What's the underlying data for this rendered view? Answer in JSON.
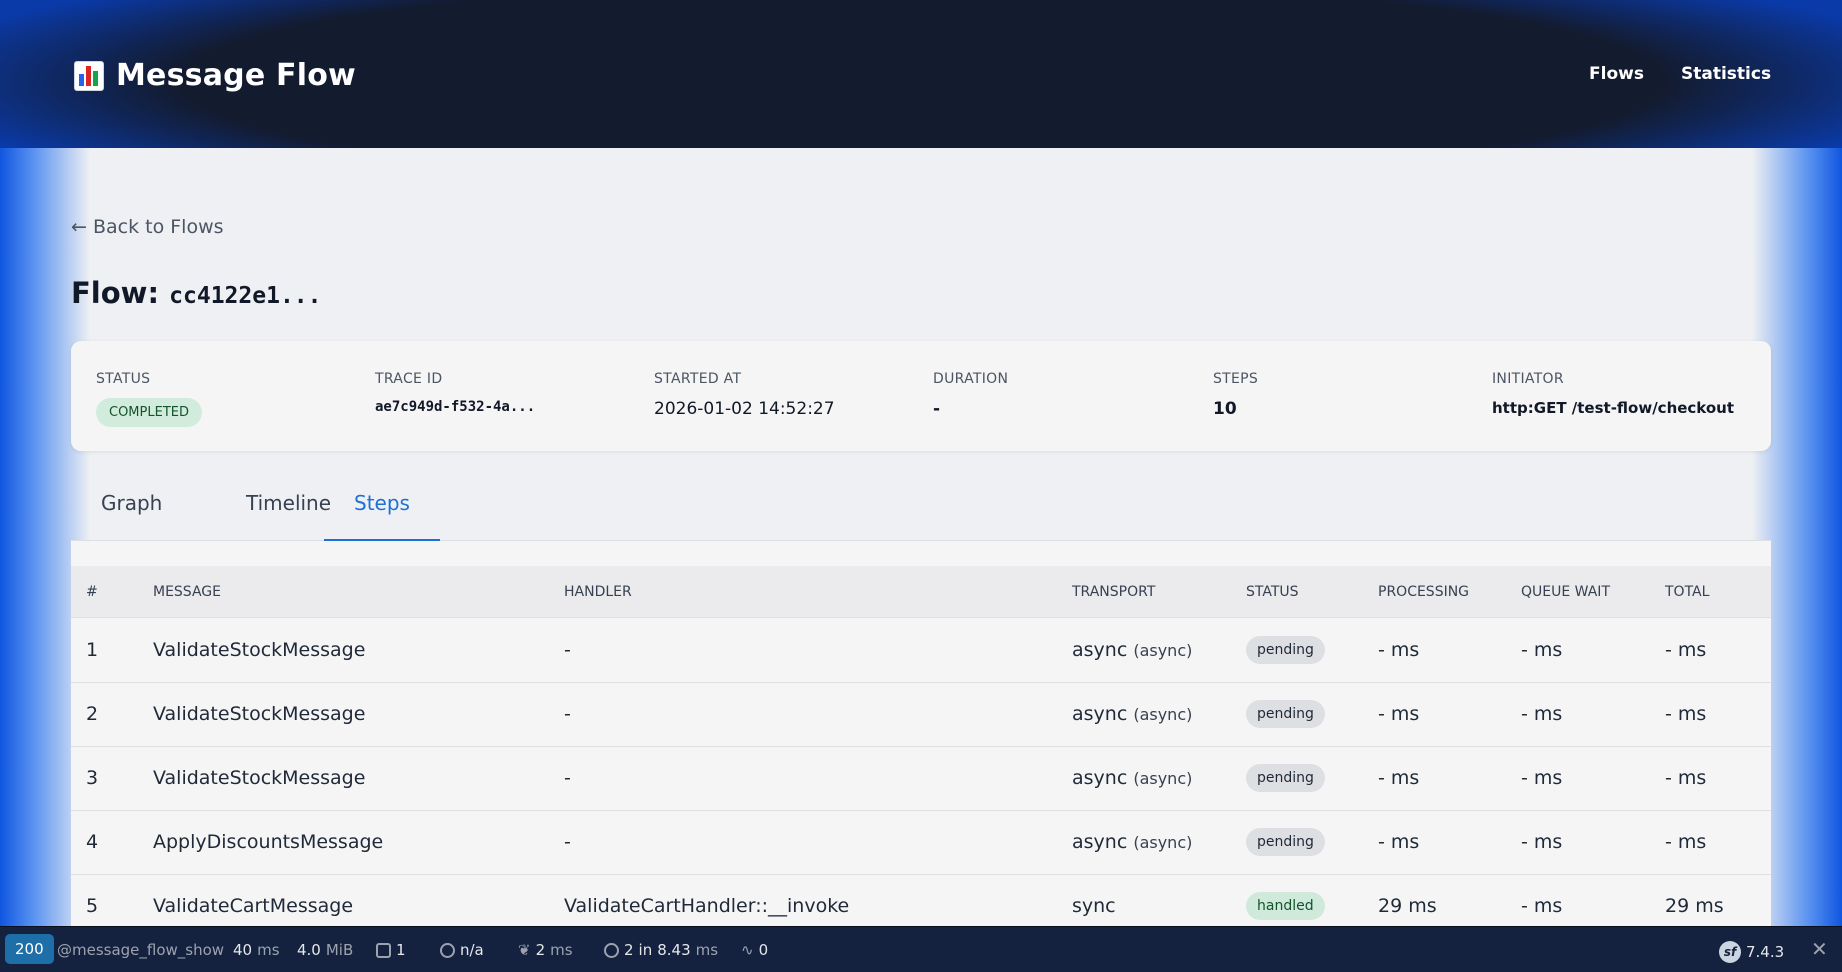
{
  "header": {
    "brand_icon": "bar-chart-icon",
    "title": "Message Flow",
    "nav": [
      {
        "label": "Flows"
      },
      {
        "label": "Statistics"
      }
    ]
  },
  "back_link": "← Back to Flows",
  "flow": {
    "title_prefix": "Flow:",
    "id_short": "cc4122e1..."
  },
  "summary": {
    "status": {
      "label": "STATUS",
      "value": "COMPLETED"
    },
    "trace_id": {
      "label": "TRACE ID",
      "value": "ae7c949d-f532-4a..."
    },
    "started_at": {
      "label": "STARTED AT",
      "value": "2026-01-02 14:52:27"
    },
    "duration": {
      "label": "DURATION",
      "value": "-"
    },
    "steps": {
      "label": "STEPS",
      "value": "10"
    },
    "initiator": {
      "label": "INITIATOR",
      "value": "http:GET /test-flow/checkout"
    }
  },
  "tabs": [
    {
      "label": "Graph"
    },
    {
      "label": "Timeline"
    },
    {
      "label": "Steps",
      "active": true
    }
  ],
  "table": {
    "columns": [
      "#",
      "MESSAGE",
      "HANDLER",
      "TRANSPORT",
      "STATUS",
      "PROCESSING",
      "QUEUE WAIT",
      "TOTAL"
    ],
    "rows": [
      {
        "num": "1",
        "message": "ValidateStockMessage",
        "handler": "-",
        "transport": "async",
        "transport_detail": "(async)",
        "status": "pending",
        "processing": "- ms",
        "queue_wait": "- ms",
        "total": "- ms"
      },
      {
        "num": "2",
        "message": "ValidateStockMessage",
        "handler": "-",
        "transport": "async",
        "transport_detail": "(async)",
        "status": "pending",
        "processing": "- ms",
        "queue_wait": "- ms",
        "total": "- ms"
      },
      {
        "num": "3",
        "message": "ValidateStockMessage",
        "handler": "-",
        "transport": "async",
        "transport_detail": "(async)",
        "status": "pending",
        "processing": "- ms",
        "queue_wait": "- ms",
        "total": "- ms"
      },
      {
        "num": "4",
        "message": "ApplyDiscountsMessage",
        "handler": "-",
        "transport": "async",
        "transport_detail": "(async)",
        "status": "pending",
        "processing": "- ms",
        "queue_wait": "- ms",
        "total": "- ms"
      },
      {
        "num": "5",
        "message": "ValidateCartMessage",
        "handler": "ValidateCartHandler::__invoke",
        "transport": "sync",
        "transport_detail": "",
        "status": "handled",
        "processing": "29 ms",
        "queue_wait": "- ms",
        "total": "29 ms"
      }
    ]
  },
  "toolbar": {
    "status_code": "200",
    "route": "@message_flow_show",
    "time_value": "40",
    "time_unit": "ms",
    "memory_value": "4.0",
    "memory_unit": "MiB",
    "files_count": "1",
    "user": "n/a",
    "twig_value": "2",
    "twig_unit": "ms",
    "db_queries": "2",
    "db_in": "in",
    "db_time": "8.43",
    "db_unit": "ms",
    "events": "0",
    "symfony_version": "7.4.3",
    "icons": [
      "file-icon",
      "user-icon",
      "leaf-icon",
      "database-icon",
      "pulse-icon",
      "symfony-logo-icon",
      "close-icon"
    ]
  },
  "colors": {
    "accent": "#1d70d6",
    "header_bg": "#131b2f",
    "pending_bg": "#dedfe2",
    "handled_bg": "#cfeadb",
    "completed_bg": "#d1ecdd"
  }
}
